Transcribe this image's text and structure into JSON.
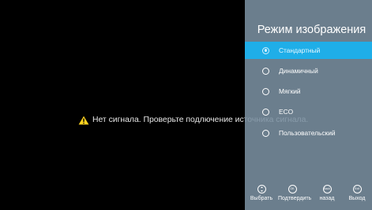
{
  "warning": {
    "message": "Нет сигнала. Проверьте подлючение источника сигнала.",
    "icon": "warning-icon",
    "icon_color": "#ffd21f"
  },
  "panel": {
    "title": "Режим изображения",
    "background": "#7a8fa0",
    "accent": "#1faee8",
    "items": [
      {
        "label": "Стандартный",
        "selected": true
      },
      {
        "label": "Динамичный",
        "selected": false
      },
      {
        "label": "Мягкий",
        "selected": false
      },
      {
        "label": "ECO",
        "selected": false
      },
      {
        "label": "Пользовательский",
        "selected": false
      }
    ]
  },
  "hints": [
    {
      "icon_text": "",
      "icon": "dpad-icon",
      "label": "Выбрать"
    },
    {
      "icon_text": "OK",
      "icon": "ok-button-icon",
      "label": "Подтвердить"
    },
    {
      "icon_text": "Back",
      "icon": "back-button-icon",
      "label": "назад"
    },
    {
      "icon_text": "Exit",
      "icon": "exit-button-icon",
      "label": "Выход"
    }
  ]
}
